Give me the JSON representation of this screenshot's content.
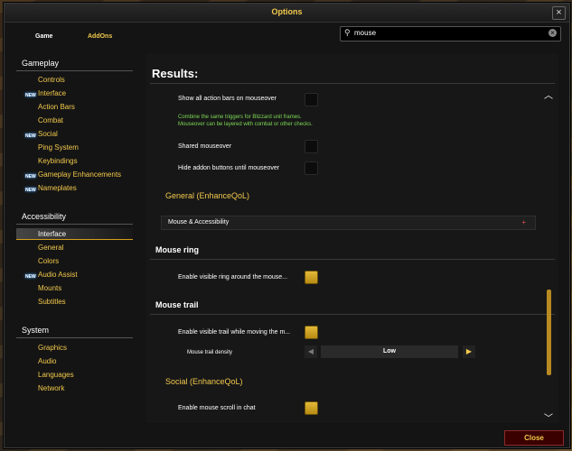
{
  "window": {
    "title": "Options"
  },
  "tabs": [
    {
      "label": "Game"
    },
    {
      "label": "AddOns"
    }
  ],
  "search": {
    "value": "mouse"
  },
  "sidebar": {
    "gameplay": {
      "title": "Gameplay",
      "items": [
        {
          "label": "Controls",
          "new": false
        },
        {
          "label": "Interface",
          "new": true
        },
        {
          "label": "Action Bars",
          "new": false
        },
        {
          "label": "Combat",
          "new": false
        },
        {
          "label": "Social",
          "new": true
        },
        {
          "label": "Ping System",
          "new": false
        },
        {
          "label": "Keybindings",
          "new": false
        },
        {
          "label": "Gameplay Enhancements",
          "new": true
        },
        {
          "label": "Nameplates",
          "new": true
        }
      ]
    },
    "accessibility": {
      "title": "Accessibility",
      "items": [
        {
          "label": "Interface",
          "new": false,
          "selected": true
        },
        {
          "label": "General",
          "new": false
        },
        {
          "label": "Colors",
          "new": false
        },
        {
          "label": "Audio Assist",
          "new": true
        },
        {
          "label": "Mounts",
          "new": false
        },
        {
          "label": "Subtitles",
          "new": false
        }
      ]
    },
    "system": {
      "title": "System",
      "items": [
        {
          "label": "Graphics"
        },
        {
          "label": "Audio"
        },
        {
          "label": "Languages"
        },
        {
          "label": "Network"
        }
      ]
    },
    "new_badge": "NEW"
  },
  "main": {
    "title": "Results:",
    "opt_show_action_bars": "Show all action bars on mouseover",
    "desc_combine": "Combine the same triggers for Blizzard unit frames.",
    "desc_layered": "Mouseover can be layered with combat or other checks.",
    "opt_shared": "Shared mouseover",
    "opt_hide_addon": "Hide addon buttons until mouseover",
    "sect_general": "General (EnhanceQoL)",
    "bar_mouse": "Mouse & Accessibility",
    "hdr_ring": "Mouse ring",
    "opt_ring": "Enable visible ring around the mouse...",
    "hdr_trail": "Mouse trail",
    "opt_trail": "Enable visible trail while moving the m...",
    "density_label": "Mouse trail density",
    "density_value": "Low",
    "sect_social": "Social (EnhanceQoL)",
    "opt_scroll": "Enable mouse scroll in chat",
    "checkbox_states": {
      "show_action_bars": false,
      "shared": false,
      "hide_addon": false,
      "ring": true,
      "trail": true,
      "scroll": true
    }
  },
  "footer": {
    "close_label": "Close"
  },
  "colors": {
    "accent": "#f2c94c",
    "checked": "#e2b93a",
    "desc_green": "#7ed957"
  }
}
